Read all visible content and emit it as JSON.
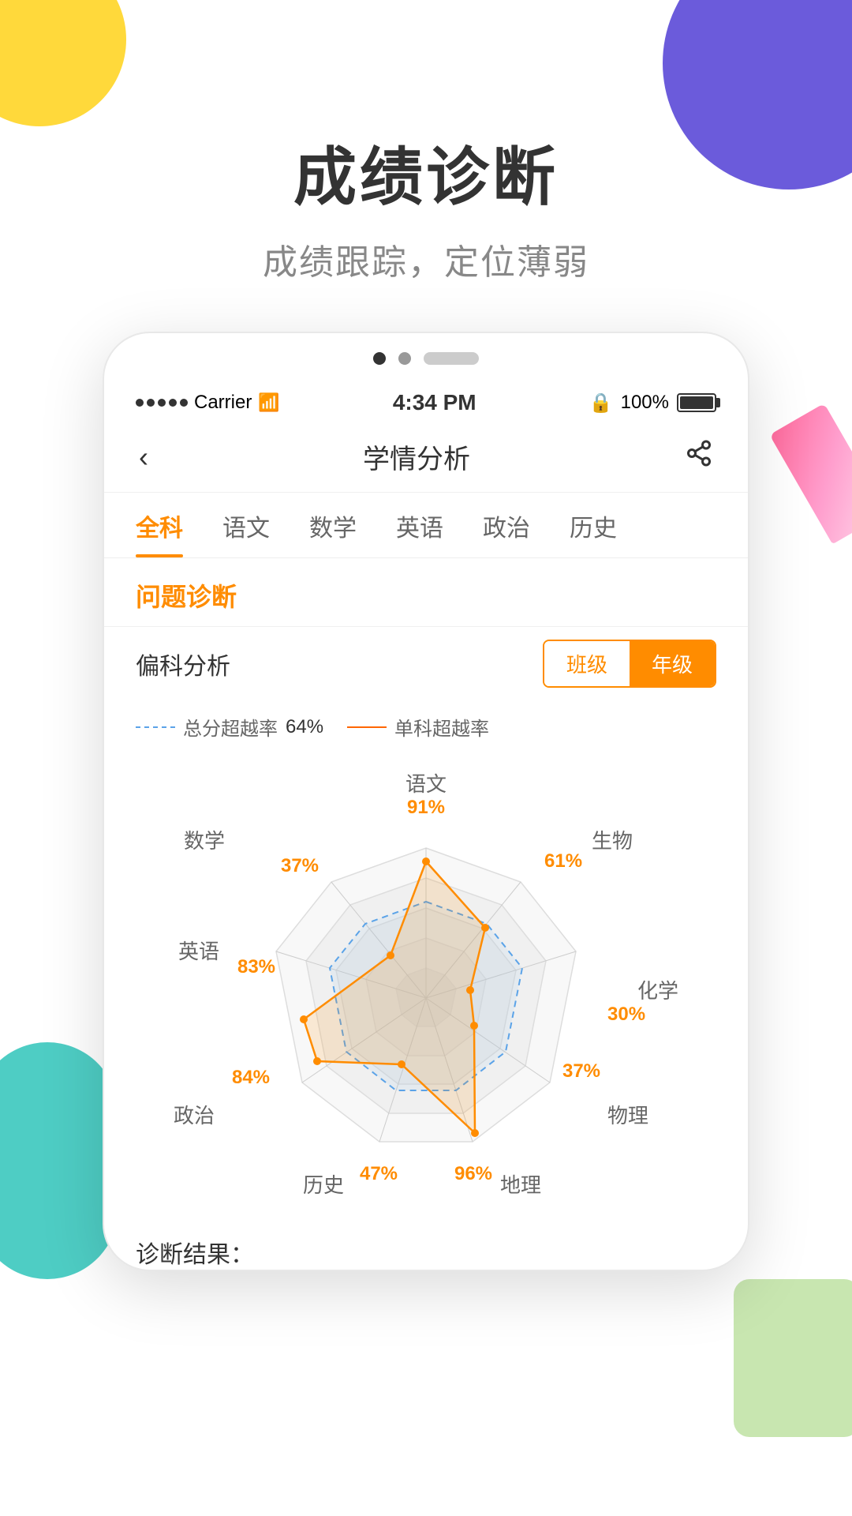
{
  "background": {
    "yellow_circle": "yellow background circle top-left",
    "purple_circle": "purple background circle top-right",
    "teal_shape": "teal background shape bottom-left",
    "green_shape": "green background shape bottom-right"
  },
  "hero": {
    "title": "成绩诊断",
    "subtitle": "成绩跟踪，定位薄弱"
  },
  "pagination": {
    "dots": [
      "active",
      "inactive",
      "line"
    ]
  },
  "status_bar": {
    "carrier": "Carrier",
    "time": "4:34 PM",
    "battery_percent": "100%"
  },
  "nav": {
    "title": "学情分析",
    "back_icon": "‹",
    "share_icon": "⋮"
  },
  "tabs": [
    {
      "label": "全科",
      "active": true
    },
    {
      "label": "语文",
      "active": false
    },
    {
      "label": "数学",
      "active": false
    },
    {
      "label": "英语",
      "active": false
    },
    {
      "label": "政治",
      "active": false
    },
    {
      "label": "历史",
      "active": false
    }
  ],
  "section": {
    "problem_diagnosis": "问题诊断",
    "analysis_label": "偏科分析"
  },
  "toggle": {
    "class_label": "班级",
    "grade_label": "年级",
    "active": "grade"
  },
  "legend": {
    "total_exceed_label": "总分超越率",
    "total_exceed_value": "64%",
    "subject_exceed_label": "单科超越率"
  },
  "radar": {
    "subjects": [
      {
        "name": "语文",
        "position": "top",
        "percent": "91%"
      },
      {
        "name": "生物",
        "position": "top-right",
        "percent": "61%"
      },
      {
        "name": "化学",
        "position": "right",
        "percent": "30%"
      },
      {
        "name": "物理",
        "position": "bottom-right",
        "percent": "37%"
      },
      {
        "name": "地理",
        "position": "bottom",
        "percent": "96%"
      },
      {
        "name": "历史",
        "position": "bottom-left",
        "percent": "47%"
      },
      {
        "name": "政治",
        "position": "left",
        "percent": "84%"
      },
      {
        "name": "英语",
        "position": "left",
        "percent": "83%"
      },
      {
        "name": "数学",
        "position": "top-left",
        "percent": "37%"
      }
    ],
    "blue_line_value": "64%",
    "orange_values": {
      "yuwen": 91,
      "shengwu": 61,
      "huaxue": 30,
      "wuli": 37,
      "dili": 96,
      "lishi": 47,
      "zhengzhi": 84,
      "yingyu": 83,
      "shuxue": 37
    }
  },
  "diagnosis": {
    "label": "诊断结果："
  }
}
